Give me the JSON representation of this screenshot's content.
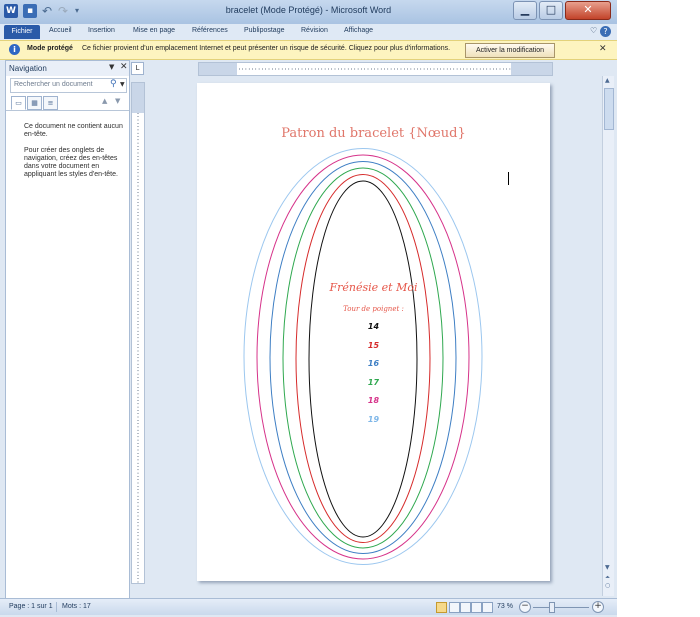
{
  "window": {
    "title": "bracelet (Mode Protégé) - Microsoft Word",
    "app_icon_label": "W",
    "minimize_glyph": "▁",
    "maximize_glyph": "□",
    "close_glyph": "✕"
  },
  "ribbon": {
    "tabs": [
      {
        "label": "Fichier"
      },
      {
        "label": "Accueil"
      },
      {
        "label": "Insertion"
      },
      {
        "label": "Mise en page"
      },
      {
        "label": "Références"
      },
      {
        "label": "Publipostage"
      },
      {
        "label": "Révision"
      },
      {
        "label": "Affichage"
      }
    ]
  },
  "protected_bar": {
    "title": "Mode protégé",
    "message": "Ce fichier provient d'un emplacement Internet et peut présenter un risque de sécurité. Cliquez pour plus d'informations.",
    "button": "Activer la modification"
  },
  "navigation": {
    "title": "Navigation",
    "search_placeholder": "Rechercher un document",
    "message1": "Ce document ne contient aucun en-tête.",
    "message2": "Pour créer des onglets de navigation, créez des en-têtes dans votre document en appliquant les styles d'en-tête."
  },
  "document": {
    "title": "Patron du bracelet {Nœud}",
    "brand": "Frénésie et Moi",
    "wrist_label": "Tour de poignet :",
    "sizes": [
      {
        "value": "14",
        "color": "#111111"
      },
      {
        "value": "15",
        "color": "#d62b2b"
      },
      {
        "value": "16",
        "color": "#3f7fc4"
      },
      {
        "value": "17",
        "color": "#2fa84f"
      },
      {
        "value": "18",
        "color": "#d6338a"
      },
      {
        "value": "19",
        "color": "#7fb7e8"
      }
    ],
    "outline_colors": [
      "#111111",
      "#d62b2b",
      "#2fa84f",
      "#3f7fc4",
      "#d6338a",
      "#9cc7ef"
    ]
  },
  "status": {
    "page": "Page : 1 sur 1",
    "words": "Mots : 17",
    "zoom": "73 %"
  },
  "colors": {
    "accent": "#2a5aa8",
    "protected_bar": "#fdf4bf",
    "title_text": "#e0766a"
  }
}
